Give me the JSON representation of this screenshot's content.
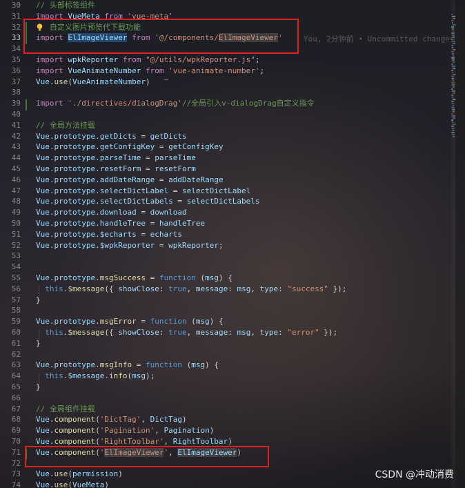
{
  "lines": [
    {
      "n": "30",
      "tokens": [
        {
          "c": "cm",
          "t": "// 头部标签组件"
        }
      ]
    },
    {
      "n": "31",
      "tokens": [
        {
          "c": "kc",
          "t": "import "
        },
        {
          "c": "id",
          "t": "VueMeta"
        },
        {
          "c": "kc",
          "t": " from "
        },
        {
          "c": "st",
          "t": "'vue-meta'"
        }
      ]
    },
    {
      "n": "32",
      "tokens": [
        {
          "c": "cm",
          "t": "   自定义图片预览代下载功能"
        }
      ]
    },
    {
      "n": "33",
      "tokens": [
        {
          "c": "kc",
          "t": "import "
        },
        {
          "c": "id hl",
          "t": "ElImageViewer"
        },
        {
          "c": "kc",
          "t": " from "
        },
        {
          "c": "st",
          "t": "'@/components/"
        },
        {
          "c": "st hl2",
          "t": "ElImageViewer"
        },
        {
          "c": "st",
          "t": "'"
        }
      ],
      "active": true
    },
    {
      "n": "34",
      "tokens": []
    },
    {
      "n": "35",
      "tokens": [
        {
          "c": "kc",
          "t": "import "
        },
        {
          "c": "id",
          "t": "wpkReporter"
        },
        {
          "c": "kc",
          "t": " from "
        },
        {
          "c": "st",
          "t": "\"@/utils/wpkReporter.js\""
        },
        {
          "c": "pl",
          "t": ";"
        }
      ]
    },
    {
      "n": "36",
      "tokens": [
        {
          "c": "kc",
          "t": "import "
        },
        {
          "c": "id",
          "t": "VueAnimateNumber"
        },
        {
          "c": "kc",
          "t": " from "
        },
        {
          "c": "st",
          "t": "'vue-animate-number'"
        },
        {
          "c": "pl",
          "t": ";"
        }
      ]
    },
    {
      "n": "37",
      "tokens": [
        {
          "c": "id",
          "t": "Vue"
        },
        {
          "c": "pl",
          "t": "."
        },
        {
          "c": "fn",
          "t": "use"
        },
        {
          "c": "pl",
          "t": "("
        },
        {
          "c": "id",
          "t": "VueAnimateNumber"
        },
        {
          "c": "pl",
          "t": ")"
        }
      ]
    },
    {
      "n": "38",
      "tokens": []
    },
    {
      "n": "39",
      "tokens": [
        {
          "c": "kc",
          "t": "import "
        },
        {
          "c": "st",
          "t": "'./directives/dialogDrag'"
        },
        {
          "c": "cm",
          "t": "//全局引入v-dialogDrag自定义指令"
        }
      ]
    },
    {
      "n": "40",
      "tokens": []
    },
    {
      "n": "41",
      "tokens": [
        {
          "c": "cm",
          "t": "// 全局方法挂载"
        }
      ]
    },
    {
      "n": "42",
      "tokens": [
        {
          "c": "id",
          "t": "Vue"
        },
        {
          "c": "pl",
          "t": "."
        },
        {
          "c": "id",
          "t": "prototype"
        },
        {
          "c": "pl",
          "t": "."
        },
        {
          "c": "id",
          "t": "getDicts"
        },
        {
          "c": "pl",
          "t": " = "
        },
        {
          "c": "id",
          "t": "getDicts"
        }
      ]
    },
    {
      "n": "43",
      "tokens": [
        {
          "c": "id",
          "t": "Vue"
        },
        {
          "c": "pl",
          "t": "."
        },
        {
          "c": "id",
          "t": "prototype"
        },
        {
          "c": "pl",
          "t": "."
        },
        {
          "c": "id",
          "t": "getConfigKey"
        },
        {
          "c": "pl",
          "t": " = "
        },
        {
          "c": "id",
          "t": "getConfigKey"
        }
      ]
    },
    {
      "n": "44",
      "tokens": [
        {
          "c": "id",
          "t": "Vue"
        },
        {
          "c": "pl",
          "t": "."
        },
        {
          "c": "id",
          "t": "prototype"
        },
        {
          "c": "pl",
          "t": "."
        },
        {
          "c": "id",
          "t": "parseTime"
        },
        {
          "c": "pl",
          "t": " = "
        },
        {
          "c": "id",
          "t": "parseTime"
        }
      ]
    },
    {
      "n": "45",
      "tokens": [
        {
          "c": "id",
          "t": "Vue"
        },
        {
          "c": "pl",
          "t": "."
        },
        {
          "c": "id",
          "t": "prototype"
        },
        {
          "c": "pl",
          "t": "."
        },
        {
          "c": "id",
          "t": "resetForm"
        },
        {
          "c": "pl",
          "t": " = "
        },
        {
          "c": "id",
          "t": "resetForm"
        }
      ]
    },
    {
      "n": "46",
      "tokens": [
        {
          "c": "id",
          "t": "Vue"
        },
        {
          "c": "pl",
          "t": "."
        },
        {
          "c": "id",
          "t": "prototype"
        },
        {
          "c": "pl",
          "t": "."
        },
        {
          "c": "id",
          "t": "addDateRange"
        },
        {
          "c": "pl",
          "t": " = "
        },
        {
          "c": "id",
          "t": "addDateRange"
        }
      ]
    },
    {
      "n": "47",
      "tokens": [
        {
          "c": "id",
          "t": "Vue"
        },
        {
          "c": "pl",
          "t": "."
        },
        {
          "c": "id",
          "t": "prototype"
        },
        {
          "c": "pl",
          "t": "."
        },
        {
          "c": "id",
          "t": "selectDictLabel"
        },
        {
          "c": "pl",
          "t": " = "
        },
        {
          "c": "id",
          "t": "selectDictLabel"
        }
      ]
    },
    {
      "n": "48",
      "tokens": [
        {
          "c": "id",
          "t": "Vue"
        },
        {
          "c": "pl",
          "t": "."
        },
        {
          "c": "id",
          "t": "prototype"
        },
        {
          "c": "pl",
          "t": "."
        },
        {
          "c": "id",
          "t": "selectDictLabels"
        },
        {
          "c": "pl",
          "t": " = "
        },
        {
          "c": "id",
          "t": "selectDictLabels"
        }
      ]
    },
    {
      "n": "49",
      "tokens": [
        {
          "c": "id",
          "t": "Vue"
        },
        {
          "c": "pl",
          "t": "."
        },
        {
          "c": "id",
          "t": "prototype"
        },
        {
          "c": "pl",
          "t": "."
        },
        {
          "c": "id",
          "t": "download"
        },
        {
          "c": "pl",
          "t": " = "
        },
        {
          "c": "id",
          "t": "download"
        }
      ]
    },
    {
      "n": "50",
      "tokens": [
        {
          "c": "id",
          "t": "Vue"
        },
        {
          "c": "pl",
          "t": "."
        },
        {
          "c": "id",
          "t": "prototype"
        },
        {
          "c": "pl",
          "t": "."
        },
        {
          "c": "id",
          "t": "handleTree"
        },
        {
          "c": "pl",
          "t": " = "
        },
        {
          "c": "id",
          "t": "handleTree"
        }
      ]
    },
    {
      "n": "51",
      "tokens": [
        {
          "c": "id",
          "t": "Vue"
        },
        {
          "c": "pl",
          "t": "."
        },
        {
          "c": "id",
          "t": "prototype"
        },
        {
          "c": "pl",
          "t": "."
        },
        {
          "c": "id",
          "t": "$echarts"
        },
        {
          "c": "pl",
          "t": " = "
        },
        {
          "c": "id",
          "t": "echarts"
        }
      ]
    },
    {
      "n": "52",
      "tokens": [
        {
          "c": "id",
          "t": "Vue"
        },
        {
          "c": "pl",
          "t": "."
        },
        {
          "c": "id",
          "t": "prototype"
        },
        {
          "c": "pl",
          "t": "."
        },
        {
          "c": "id",
          "t": "$wpkReporter"
        },
        {
          "c": "pl",
          "t": " = "
        },
        {
          "c": "id",
          "t": "wpkReporter"
        },
        {
          "c": "pl",
          "t": ";"
        }
      ]
    },
    {
      "n": "53",
      "tokens": []
    },
    {
      "n": "54",
      "tokens": []
    },
    {
      "n": "55",
      "tokens": [
        {
          "c": "id",
          "t": "Vue"
        },
        {
          "c": "pl",
          "t": "."
        },
        {
          "c": "id",
          "t": "prototype"
        },
        {
          "c": "pl",
          "t": "."
        },
        {
          "c": "fn",
          "t": "msgSuccess"
        },
        {
          "c": "pl",
          "t": " = "
        },
        {
          "c": "kw",
          "t": "function"
        },
        {
          "c": "pl",
          "t": " ("
        },
        {
          "c": "id",
          "t": "msg"
        },
        {
          "c": "pl",
          "t": ") {"
        }
      ]
    },
    {
      "n": "56",
      "tokens": [
        {
          "c": "pl",
          "t": "  "
        },
        {
          "c": "kw",
          "t": "this"
        },
        {
          "c": "pl",
          "t": "."
        },
        {
          "c": "fn",
          "t": "$message"
        },
        {
          "c": "pl",
          "t": "({ "
        },
        {
          "c": "id",
          "t": "showClose"
        },
        {
          "c": "pl",
          "t": ": "
        },
        {
          "c": "kw",
          "t": "true"
        },
        {
          "c": "pl",
          "t": ", "
        },
        {
          "c": "id",
          "t": "message"
        },
        {
          "c": "pl",
          "t": ": "
        },
        {
          "c": "id",
          "t": "msg"
        },
        {
          "c": "pl",
          "t": ", "
        },
        {
          "c": "id",
          "t": "type"
        },
        {
          "c": "pl",
          "t": ": "
        },
        {
          "c": "st",
          "t": "\"success\""
        },
        {
          "c": "pl",
          "t": " });"
        }
      ]
    },
    {
      "n": "57",
      "tokens": [
        {
          "c": "pl",
          "t": "}"
        }
      ]
    },
    {
      "n": "58",
      "tokens": []
    },
    {
      "n": "59",
      "tokens": [
        {
          "c": "id",
          "t": "Vue"
        },
        {
          "c": "pl",
          "t": "."
        },
        {
          "c": "id",
          "t": "prototype"
        },
        {
          "c": "pl",
          "t": "."
        },
        {
          "c": "fn",
          "t": "msgError"
        },
        {
          "c": "pl",
          "t": " = "
        },
        {
          "c": "kw",
          "t": "function"
        },
        {
          "c": "pl",
          "t": " ("
        },
        {
          "c": "id",
          "t": "msg"
        },
        {
          "c": "pl",
          "t": ") {"
        }
      ]
    },
    {
      "n": "60",
      "tokens": [
        {
          "c": "pl",
          "t": "  "
        },
        {
          "c": "kw",
          "t": "this"
        },
        {
          "c": "pl",
          "t": "."
        },
        {
          "c": "fn",
          "t": "$message"
        },
        {
          "c": "pl",
          "t": "({ "
        },
        {
          "c": "id",
          "t": "showClose"
        },
        {
          "c": "pl",
          "t": ": "
        },
        {
          "c": "kw",
          "t": "true"
        },
        {
          "c": "pl",
          "t": ", "
        },
        {
          "c": "id",
          "t": "message"
        },
        {
          "c": "pl",
          "t": ": "
        },
        {
          "c": "id",
          "t": "msg"
        },
        {
          "c": "pl",
          "t": ", "
        },
        {
          "c": "id",
          "t": "type"
        },
        {
          "c": "pl",
          "t": ": "
        },
        {
          "c": "st",
          "t": "\"error\""
        },
        {
          "c": "pl",
          "t": " });"
        }
      ]
    },
    {
      "n": "61",
      "tokens": [
        {
          "c": "pl",
          "t": "}"
        }
      ]
    },
    {
      "n": "62",
      "tokens": []
    },
    {
      "n": "63",
      "tokens": [
        {
          "c": "id",
          "t": "Vue"
        },
        {
          "c": "pl",
          "t": "."
        },
        {
          "c": "id",
          "t": "prototype"
        },
        {
          "c": "pl",
          "t": "."
        },
        {
          "c": "fn",
          "t": "msgInfo"
        },
        {
          "c": "pl",
          "t": " = "
        },
        {
          "c": "kw",
          "t": "function"
        },
        {
          "c": "pl",
          "t": " ("
        },
        {
          "c": "id",
          "t": "msg"
        },
        {
          "c": "pl",
          "t": ") {"
        }
      ]
    },
    {
      "n": "64",
      "tokens": [
        {
          "c": "pl",
          "t": "  "
        },
        {
          "c": "kw",
          "t": "this"
        },
        {
          "c": "pl",
          "t": "."
        },
        {
          "c": "id",
          "t": "$message"
        },
        {
          "c": "pl",
          "t": "."
        },
        {
          "c": "fn",
          "t": "info"
        },
        {
          "c": "pl",
          "t": "("
        },
        {
          "c": "id",
          "t": "msg"
        },
        {
          "c": "pl",
          "t": ");"
        }
      ]
    },
    {
      "n": "65",
      "tokens": [
        {
          "c": "pl",
          "t": "}"
        }
      ]
    },
    {
      "n": "66",
      "tokens": []
    },
    {
      "n": "67",
      "tokens": [
        {
          "c": "cm",
          "t": "// 全局组件挂载"
        }
      ]
    },
    {
      "n": "68",
      "tokens": [
        {
          "c": "id",
          "t": "Vue"
        },
        {
          "c": "pl",
          "t": "."
        },
        {
          "c": "fn",
          "t": "component"
        },
        {
          "c": "pl",
          "t": "("
        },
        {
          "c": "st",
          "t": "'DictTag'"
        },
        {
          "c": "pl",
          "t": ", "
        },
        {
          "c": "id",
          "t": "DictTag"
        },
        {
          "c": "pl",
          "t": ")"
        }
      ]
    },
    {
      "n": "69",
      "tokens": [
        {
          "c": "id",
          "t": "Vue"
        },
        {
          "c": "pl",
          "t": "."
        },
        {
          "c": "fn",
          "t": "component"
        },
        {
          "c": "pl",
          "t": "("
        },
        {
          "c": "st",
          "t": "'Pagination'"
        },
        {
          "c": "pl",
          "t": ", "
        },
        {
          "c": "id",
          "t": "Pagination"
        },
        {
          "c": "pl",
          "t": ")"
        }
      ]
    },
    {
      "n": "70",
      "tokens": [
        {
          "c": "id",
          "t": "Vue"
        },
        {
          "c": "pl",
          "t": "."
        },
        {
          "c": "fn",
          "t": "component"
        },
        {
          "c": "pl",
          "t": "("
        },
        {
          "c": "st",
          "t": "'RightToolbar'"
        },
        {
          "c": "pl",
          "t": ", "
        },
        {
          "c": "id",
          "t": "RightToolbar"
        },
        {
          "c": "pl",
          "t": ")"
        }
      ]
    },
    {
      "n": "71",
      "tokens": [
        {
          "c": "id",
          "t": "Vue"
        },
        {
          "c": "pl",
          "t": "."
        },
        {
          "c": "fn",
          "t": "component"
        },
        {
          "c": "pl",
          "t": "("
        },
        {
          "c": "st",
          "t": "'"
        },
        {
          "c": "st hl2",
          "t": "ElImageViewer"
        },
        {
          "c": "st",
          "t": "'"
        },
        {
          "c": "pl",
          "t": ", "
        },
        {
          "c": "id hl2",
          "t": "ElImageViewer"
        },
        {
          "c": "pl",
          "t": ")"
        }
      ]
    },
    {
      "n": "72",
      "tokens": []
    },
    {
      "n": "73",
      "tokens": [
        {
          "c": "id",
          "t": "Vue"
        },
        {
          "c": "pl",
          "t": "."
        },
        {
          "c": "fn",
          "t": "use"
        },
        {
          "c": "pl",
          "t": "("
        },
        {
          "c": "id",
          "t": "permission"
        },
        {
          "c": "pl",
          "t": ")"
        }
      ]
    },
    {
      "n": "74",
      "tokens": [
        {
          "c": "id",
          "t": "Vue"
        },
        {
          "c": "pl",
          "t": "."
        },
        {
          "c": "fn",
          "t": "use"
        },
        {
          "c": "pl",
          "t": "("
        },
        {
          "c": "id",
          "t": "VueMeta"
        },
        {
          "c": "pl",
          "t": ")"
        }
      ]
    }
  ],
  "blame": "You, 2分钟前 • Uncommitted changes",
  "watermark": "CSDN @冲动消费",
  "colors": {
    "highlight_box": "#e02020",
    "comment": "#6a9955",
    "keyword": "#569cd6",
    "import": "#c586c0",
    "string": "#ce9178",
    "identifier": "#9cdcfe"
  }
}
